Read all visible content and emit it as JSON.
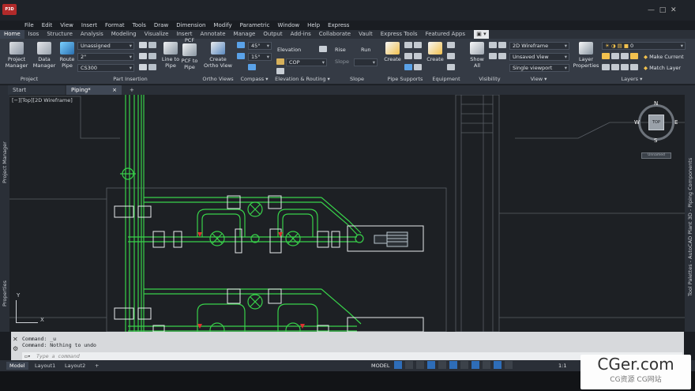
{
  "app": {
    "logo_text": "P3D"
  },
  "menu": [
    "File",
    "Edit",
    "View",
    "Insert",
    "Format",
    "Tools",
    "Draw",
    "Dimension",
    "Modify",
    "Parametric",
    "Window",
    "Help",
    "Express"
  ],
  "ribbon_tabs": [
    "Home",
    "Isos",
    "Structure",
    "Analysis",
    "Modeling",
    "Visualize",
    "Insert",
    "Annotate",
    "Manage",
    "Output",
    "Add-ins",
    "Collaborate",
    "Vault",
    "Express Tools",
    "Featured Apps"
  ],
  "ribbon": {
    "project_manager": "Project\nManager",
    "data_manager": "Data\nManager",
    "route_pipe": "Route\nPipe",
    "line_to_pipe": "Line to\nPipe",
    "pcf_label": "PCF",
    "pcf_to_pipe": "PCF to\nPipe",
    "create_ortho": "Create\nOrtho View",
    "spec_combo": "Unassigned",
    "size_combo": "2\"",
    "material_combo": "CS300",
    "angle1": "45°",
    "angle2": "15°",
    "elevation_label": "Elevation",
    "elevation_combo": "COP",
    "rise_label": "Rise",
    "run_label": "Run",
    "slope_label": "Slope",
    "pipe_supports_create": "Create",
    "equipment_create": "Create",
    "show_all": "Show\nAll",
    "visual_style": "2D Wireframe",
    "saved_view": "Unsaved View",
    "viewport_mode": "Single viewport",
    "layer_props": "Layer\nProperties",
    "layer_combo": "0",
    "make_current": "Make Current",
    "match_layer": "Match Layer",
    "panels": [
      "Project",
      "Part Insertion",
      "Ortho Views",
      "Compass",
      "Elevation & Routing",
      "Slope",
      "Pipe Supports",
      "Equipment",
      "Visibility",
      "View",
      "Layers"
    ]
  },
  "doc_tabs": {
    "start": "Start",
    "piping": "Piping*",
    "close": "×",
    "plus": "+"
  },
  "viewport": {
    "label": "[−][Top][2D Wireframe]",
    "compass": {
      "n": "N",
      "s": "S",
      "e": "E",
      "w": "W",
      "top": "TOP"
    },
    "wcs": "Unnamed",
    "ucs_x": "X",
    "ucs_y": "Y"
  },
  "left_strip": {
    "project_manager": "Project Manager",
    "properties": "Properties"
  },
  "right_strip": {
    "tool_palettes": "Tool Palettes - AutoCAD Plant 3D - Piping Components"
  },
  "command": {
    "history": [
      "Command: _u",
      "Command: Nothing to undo"
    ],
    "placeholder": "Type a command"
  },
  "layout_tabs": [
    "Model",
    "Layout1",
    "Layout2"
  ],
  "status": {
    "model": "MODEL",
    "scale": "1:1"
  },
  "watermark": {
    "line1": "CGer.com",
    "line2": "CG资源 CG网站"
  },
  "colors": {
    "pipe": "#38d14a",
    "valve": "#39e04a",
    "red_marker": "#e03030",
    "equipment": "#b8c4cc"
  }
}
